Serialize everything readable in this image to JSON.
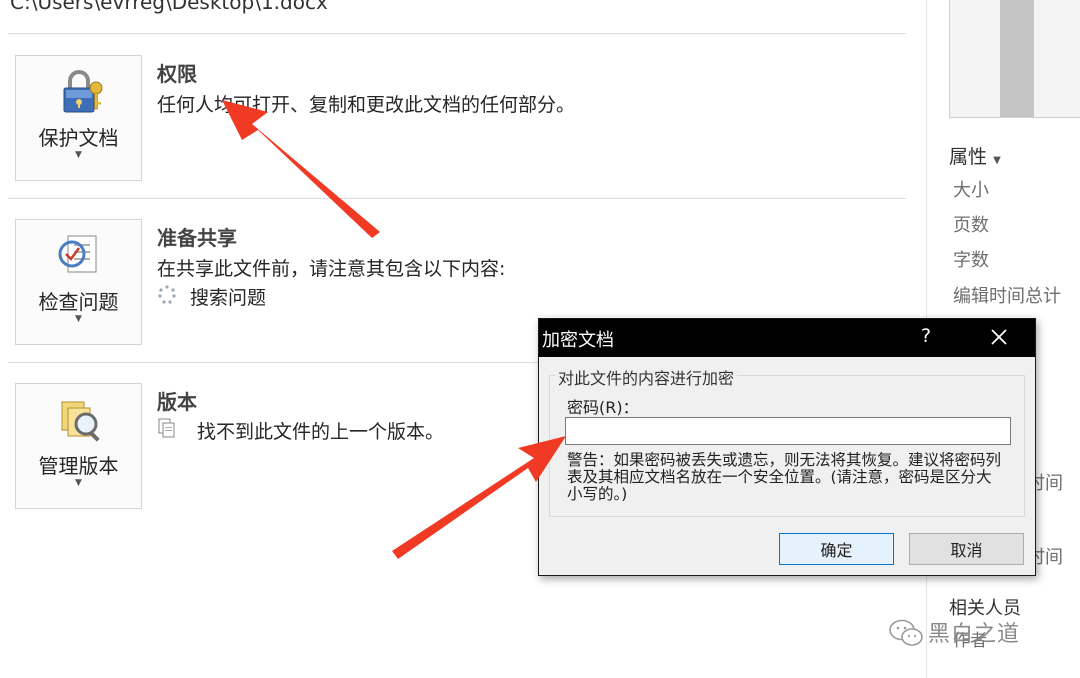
{
  "path": "C:\\Users\\evrreg\\Desktop\\1.docx",
  "sections": {
    "permissions": {
      "button_label": "保护文档",
      "title": "权限",
      "description": "任何人均可打开、复制和更改此文档的任何部分。"
    },
    "prepare": {
      "button_label": "检查问题",
      "title": "准备共享",
      "description": "在共享此文件前，请注意其包含以下内容:",
      "item": "搜索问题"
    },
    "versions": {
      "button_label": "管理版本",
      "title": "版本",
      "item": "找不到此文件的上一个版本。"
    }
  },
  "properties": {
    "title": "属性",
    "items": [
      "大小",
      "页数",
      "字数",
      "编辑时间总计"
    ],
    "peek1": "时间",
    "peek2": "时间",
    "related": "相关人员",
    "author": "作者"
  },
  "dialog": {
    "title": "加密文档",
    "help": "?",
    "group_label": "对此文件的内容进行加密",
    "password_label": "密码(R)：",
    "password_value": "",
    "warning": "警告：如果密码被丢失或遗忘，则无法将其恢复。建议将密码列表及其相应文档名放在一个安全位置。(请注意，密码是区分大小写的。)",
    "ok": "确定",
    "cancel": "取消"
  },
  "watermark": "黑白之道",
  "colors": {
    "arrow": "#f03a24",
    "dialog_title_bg": "#000000",
    "ok_border": "#0078d7"
  },
  "icons": [
    "lock-key-icon",
    "checklist-icon",
    "version-files-icon",
    "spinner-icon",
    "document-icon",
    "close-icon",
    "wechat-icon",
    "caret-down-icon"
  ]
}
